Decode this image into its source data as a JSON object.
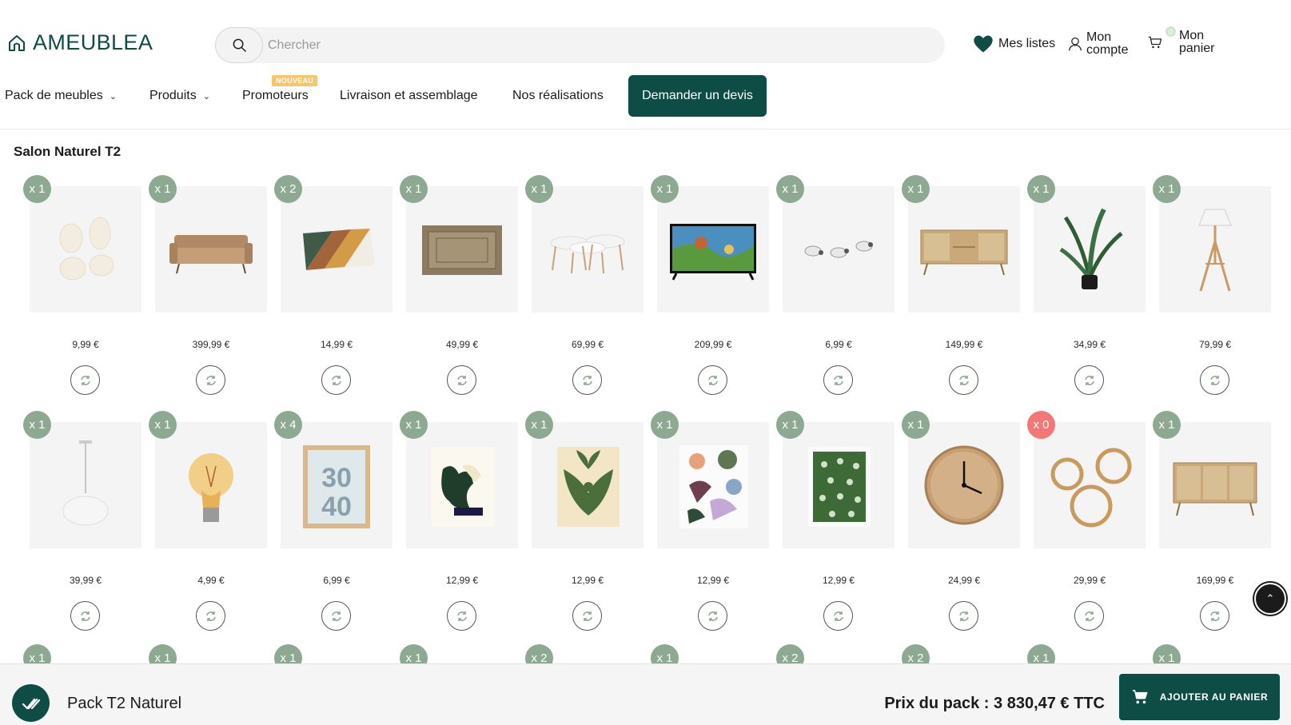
{
  "brand": {
    "name": "AMEUBLEA",
    "color": "#0e4d45"
  },
  "search": {
    "placeholder": "Chercher"
  },
  "header_links": {
    "lists": "Mes listes",
    "account_line1": "Mon",
    "account_line2": "compte",
    "cart_line1": "Mon",
    "cart_line2": "panier",
    "cart_count": "0"
  },
  "nav": {
    "items": [
      {
        "label": "Pack de meubles",
        "has_dropdown": true
      },
      {
        "label": "Produits",
        "has_dropdown": true
      },
      {
        "label": "Promoteurs",
        "has_dropdown": false,
        "badge": "NOUVEAU"
      },
      {
        "label": "Livraison et assemblage",
        "has_dropdown": false
      },
      {
        "label": "Nos réalisations",
        "has_dropdown": false
      }
    ],
    "cta": "Demander un devis"
  },
  "section": {
    "title": "Salon Naturel T2"
  },
  "products_row1": [
    {
      "qty": "x 1",
      "price": "9,99 €",
      "icon": "mirror-set-icon"
    },
    {
      "qty": "x 1",
      "price": "399,99 €",
      "icon": "sofa-icon"
    },
    {
      "qty": "x 2",
      "price": "14,99 €",
      "icon": "cushion-icon"
    },
    {
      "qty": "x 1",
      "price": "49,99 €",
      "icon": "rug-icon"
    },
    {
      "qty": "x 1",
      "price": "69,99 €",
      "icon": "nesting-tables-icon"
    },
    {
      "qty": "x 1",
      "price": "209,99 €",
      "icon": "tv-icon"
    },
    {
      "qty": "x 1",
      "price": "6,99 €",
      "icon": "bulbs-icon"
    },
    {
      "qty": "x 1",
      "price": "149,99 €",
      "icon": "tv-cabinet-icon"
    },
    {
      "qty": "x 1",
      "price": "34,99 €",
      "icon": "plant-icon"
    },
    {
      "qty": "x 1",
      "price": "79,99 €",
      "icon": "floor-lamp-icon"
    }
  ],
  "products_row2": [
    {
      "qty": "x 1",
      "price": "39,99 €",
      "icon": "pendant-lamp-icon"
    },
    {
      "qty": "x 1",
      "price": "4,99 €",
      "icon": "light-bulb-icon"
    },
    {
      "qty": "x 4",
      "price": "6,99 €",
      "icon": "photo-frame-icon"
    },
    {
      "qty": "x 1",
      "price": "12,99 €",
      "icon": "abstract-poster-icon"
    },
    {
      "qty": "x 1",
      "price": "12,99 €",
      "icon": "leaf-poster-icon"
    },
    {
      "qty": "x 1",
      "price": "12,99 €",
      "icon": "shapes-poster-icon"
    },
    {
      "qty": "x 1",
      "price": "12,99 €",
      "icon": "floral-poster-icon"
    },
    {
      "qty": "x 1",
      "price": "24,99 €",
      "icon": "wall-clock-icon"
    },
    {
      "qty": "x 0",
      "price": "29,99 €",
      "icon": "ring-mirrors-icon"
    },
    {
      "qty": "x 1",
      "price": "169,99 €",
      "icon": "sideboard-icon"
    }
  ],
  "products_row3_qty": [
    "x 1",
    "x 1",
    "x 1",
    "x 1",
    "x 2",
    "x 1",
    "x 2",
    "x 2",
    "x 1",
    "x 1"
  ],
  "bottom_bar": {
    "pack_name": "Pack T2 Naturel",
    "pack_price": "Prix du pack : 3 830,47 € TTC",
    "add_to_cart": "AJOUTER AU PANIER"
  },
  "colors": {
    "accent": "#0e4d45",
    "qty_badge": "#8ea991",
    "qty_zero": "#f47777",
    "nouveau": "#f6c56c"
  }
}
